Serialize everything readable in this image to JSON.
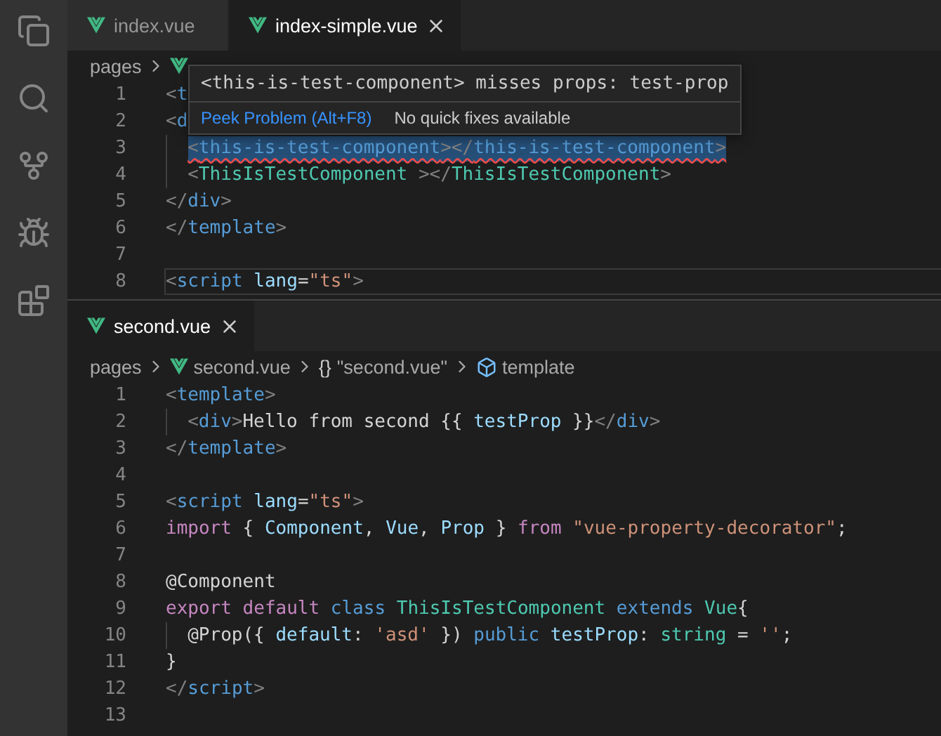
{
  "editors": [
    {
      "tabs": [
        {
          "label": "index.vue",
          "selected": false
        },
        {
          "label": "index-simple.vue",
          "selected": true
        }
      ],
      "breadcrumb": [
        {
          "kind": "folder",
          "text": "pages"
        },
        {
          "kind": "vue"
        }
      ],
      "hover": {
        "message": "<this-is-test-component> misses props: test-prop",
        "action": "Peek Problem (Alt+F8)",
        "note": "No quick fixes available"
      },
      "lines": [
        {
          "number": "1",
          "tokens": [
            {
              "kind": "punct",
              "text": "<"
            },
            {
              "kind": "tag",
              "text": "t"
            }
          ]
        },
        {
          "number": "2",
          "tokens": [
            {
              "kind": "punct",
              "text": "<"
            },
            {
              "kind": "tag",
              "text": "d"
            }
          ]
        },
        {
          "number": "3",
          "indented": true,
          "problem": true,
          "tokens": [
            {
              "kind": "punct",
              "text": "<"
            },
            {
              "kind": "tag",
              "text": "this-is-test-component"
            },
            {
              "kind": "punct",
              "text": "></"
            },
            {
              "kind": "tag",
              "text": "this-is-test-component"
            },
            {
              "kind": "punct",
              "text": ">"
            }
          ]
        },
        {
          "number": "4",
          "indented": true,
          "tokens": [
            {
              "kind": "punct",
              "text": "<"
            },
            {
              "kind": "type",
              "text": "ThisIsTestComponent"
            },
            {
              "kind": "punct",
              "text": " ></"
            },
            {
              "kind": "type",
              "text": "ThisIsTestComponent"
            },
            {
              "kind": "punct",
              "text": ">"
            }
          ]
        },
        {
          "number": "5",
          "tokens": [
            {
              "kind": "punct",
              "text": "</"
            },
            {
              "kind": "tag",
              "text": "div"
            },
            {
              "kind": "punct",
              "text": ">"
            }
          ]
        },
        {
          "number": "6",
          "tokens": [
            {
              "kind": "punct",
              "text": "</"
            },
            {
              "kind": "tag",
              "text": "template"
            },
            {
              "kind": "punct",
              "text": ">"
            }
          ]
        },
        {
          "number": "7"
        },
        {
          "number": "8",
          "current": true,
          "tokens": [
            {
              "kind": "punct",
              "text": "<"
            },
            {
              "kind": "tag",
              "text": "script "
            },
            {
              "kind": "attr",
              "text": "lang"
            },
            {
              "kind": "text",
              "text": "="
            },
            {
              "kind": "string",
              "text": "\"ts\""
            },
            {
              "kind": "punct",
              "text": ">"
            }
          ]
        }
      ]
    },
    {
      "tabs": [
        {
          "label": "second.vue",
          "selected": true
        }
      ],
      "breadcrumb": [
        {
          "kind": "folder",
          "text": "pages"
        },
        {
          "kind": "vue",
          "text": "second.vue"
        },
        {
          "kind": "braces",
          "glyph": "{}",
          "text": "\"second.vue\""
        },
        {
          "kind": "element",
          "text": "template"
        }
      ],
      "lines": [
        {
          "number": "1",
          "tokens": [
            {
              "kind": "punct",
              "text": "<"
            },
            {
              "kind": "tag",
              "text": "template"
            },
            {
              "kind": "punct",
              "text": ">"
            }
          ]
        },
        {
          "number": "2",
          "indented": true,
          "tokens": [
            {
              "kind": "punct",
              "text": "<"
            },
            {
              "kind": "tag",
              "text": "div"
            },
            {
              "kind": "punct",
              "text": ">"
            },
            {
              "kind": "text",
              "text": "Hello from second {{ "
            },
            {
              "kind": "attr",
              "text": "testProp"
            },
            {
              "kind": "text",
              "text": " }}"
            },
            {
              "kind": "punct",
              "text": "</"
            },
            {
              "kind": "tag",
              "text": "div"
            },
            {
              "kind": "punct",
              "text": ">"
            }
          ]
        },
        {
          "number": "3",
          "tokens": [
            {
              "kind": "punct",
              "text": "</"
            },
            {
              "kind": "tag",
              "text": "template"
            },
            {
              "kind": "punct",
              "text": ">"
            }
          ]
        },
        {
          "number": "4"
        },
        {
          "number": "5",
          "tokens": [
            {
              "kind": "punct",
              "text": "<"
            },
            {
              "kind": "tag",
              "text": "script "
            },
            {
              "kind": "attr",
              "text": "lang"
            },
            {
              "kind": "text",
              "text": "="
            },
            {
              "kind": "string",
              "text": "\"ts\""
            },
            {
              "kind": "punct",
              "text": ">"
            }
          ]
        },
        {
          "number": "6",
          "tokens": [
            {
              "kind": "control",
              "text": "import"
            },
            {
              "kind": "text",
              "text": " { "
            },
            {
              "kind": "attr",
              "text": "Component"
            },
            {
              "kind": "text",
              "text": ", "
            },
            {
              "kind": "attr",
              "text": "Vue"
            },
            {
              "kind": "text",
              "text": ", "
            },
            {
              "kind": "attr",
              "text": "Prop"
            },
            {
              "kind": "text",
              "text": " } "
            },
            {
              "kind": "control",
              "text": "from "
            },
            {
              "kind": "string",
              "text": "\"vue-property-decorator\""
            },
            {
              "kind": "text",
              "text": ";"
            }
          ]
        },
        {
          "number": "7"
        },
        {
          "number": "8",
          "tokens": [
            {
              "kind": "text",
              "text": "@Component"
            }
          ]
        },
        {
          "number": "9",
          "tokens": [
            {
              "kind": "control",
              "text": "export default "
            },
            {
              "kind": "keyword",
              "text": "class "
            },
            {
              "kind": "type",
              "text": "ThisIsTestComponent "
            },
            {
              "kind": "keyword",
              "text": "extends "
            },
            {
              "kind": "type",
              "text": "Vue"
            },
            {
              "kind": "text",
              "text": "{"
            }
          ]
        },
        {
          "number": "10",
          "indented": true,
          "tokens": [
            {
              "kind": "text",
              "text": "@Prop({ "
            },
            {
              "kind": "attr",
              "text": "default"
            },
            {
              "kind": "text",
              "text": ": "
            },
            {
              "kind": "string",
              "text": "'asd'"
            },
            {
              "kind": "text",
              "text": " }) "
            },
            {
              "kind": "keyword",
              "text": "public "
            },
            {
              "kind": "attr",
              "text": "testProp"
            },
            {
              "kind": "text",
              "text": ": "
            },
            {
              "kind": "type",
              "text": "string"
            },
            {
              "kind": "text",
              "text": " = "
            },
            {
              "kind": "string",
              "text": "''"
            },
            {
              "kind": "text",
              "text": ";"
            }
          ]
        },
        {
          "number": "11",
          "tokens": [
            {
              "kind": "text",
              "text": "}"
            }
          ]
        },
        {
          "number": "12",
          "tokens": [
            {
              "kind": "punct",
              "text": "</"
            },
            {
              "kind": "tag",
              "text": "script"
            },
            {
              "kind": "punct",
              "text": ">"
            }
          ]
        },
        {
          "number": "13"
        }
      ]
    }
  ]
}
